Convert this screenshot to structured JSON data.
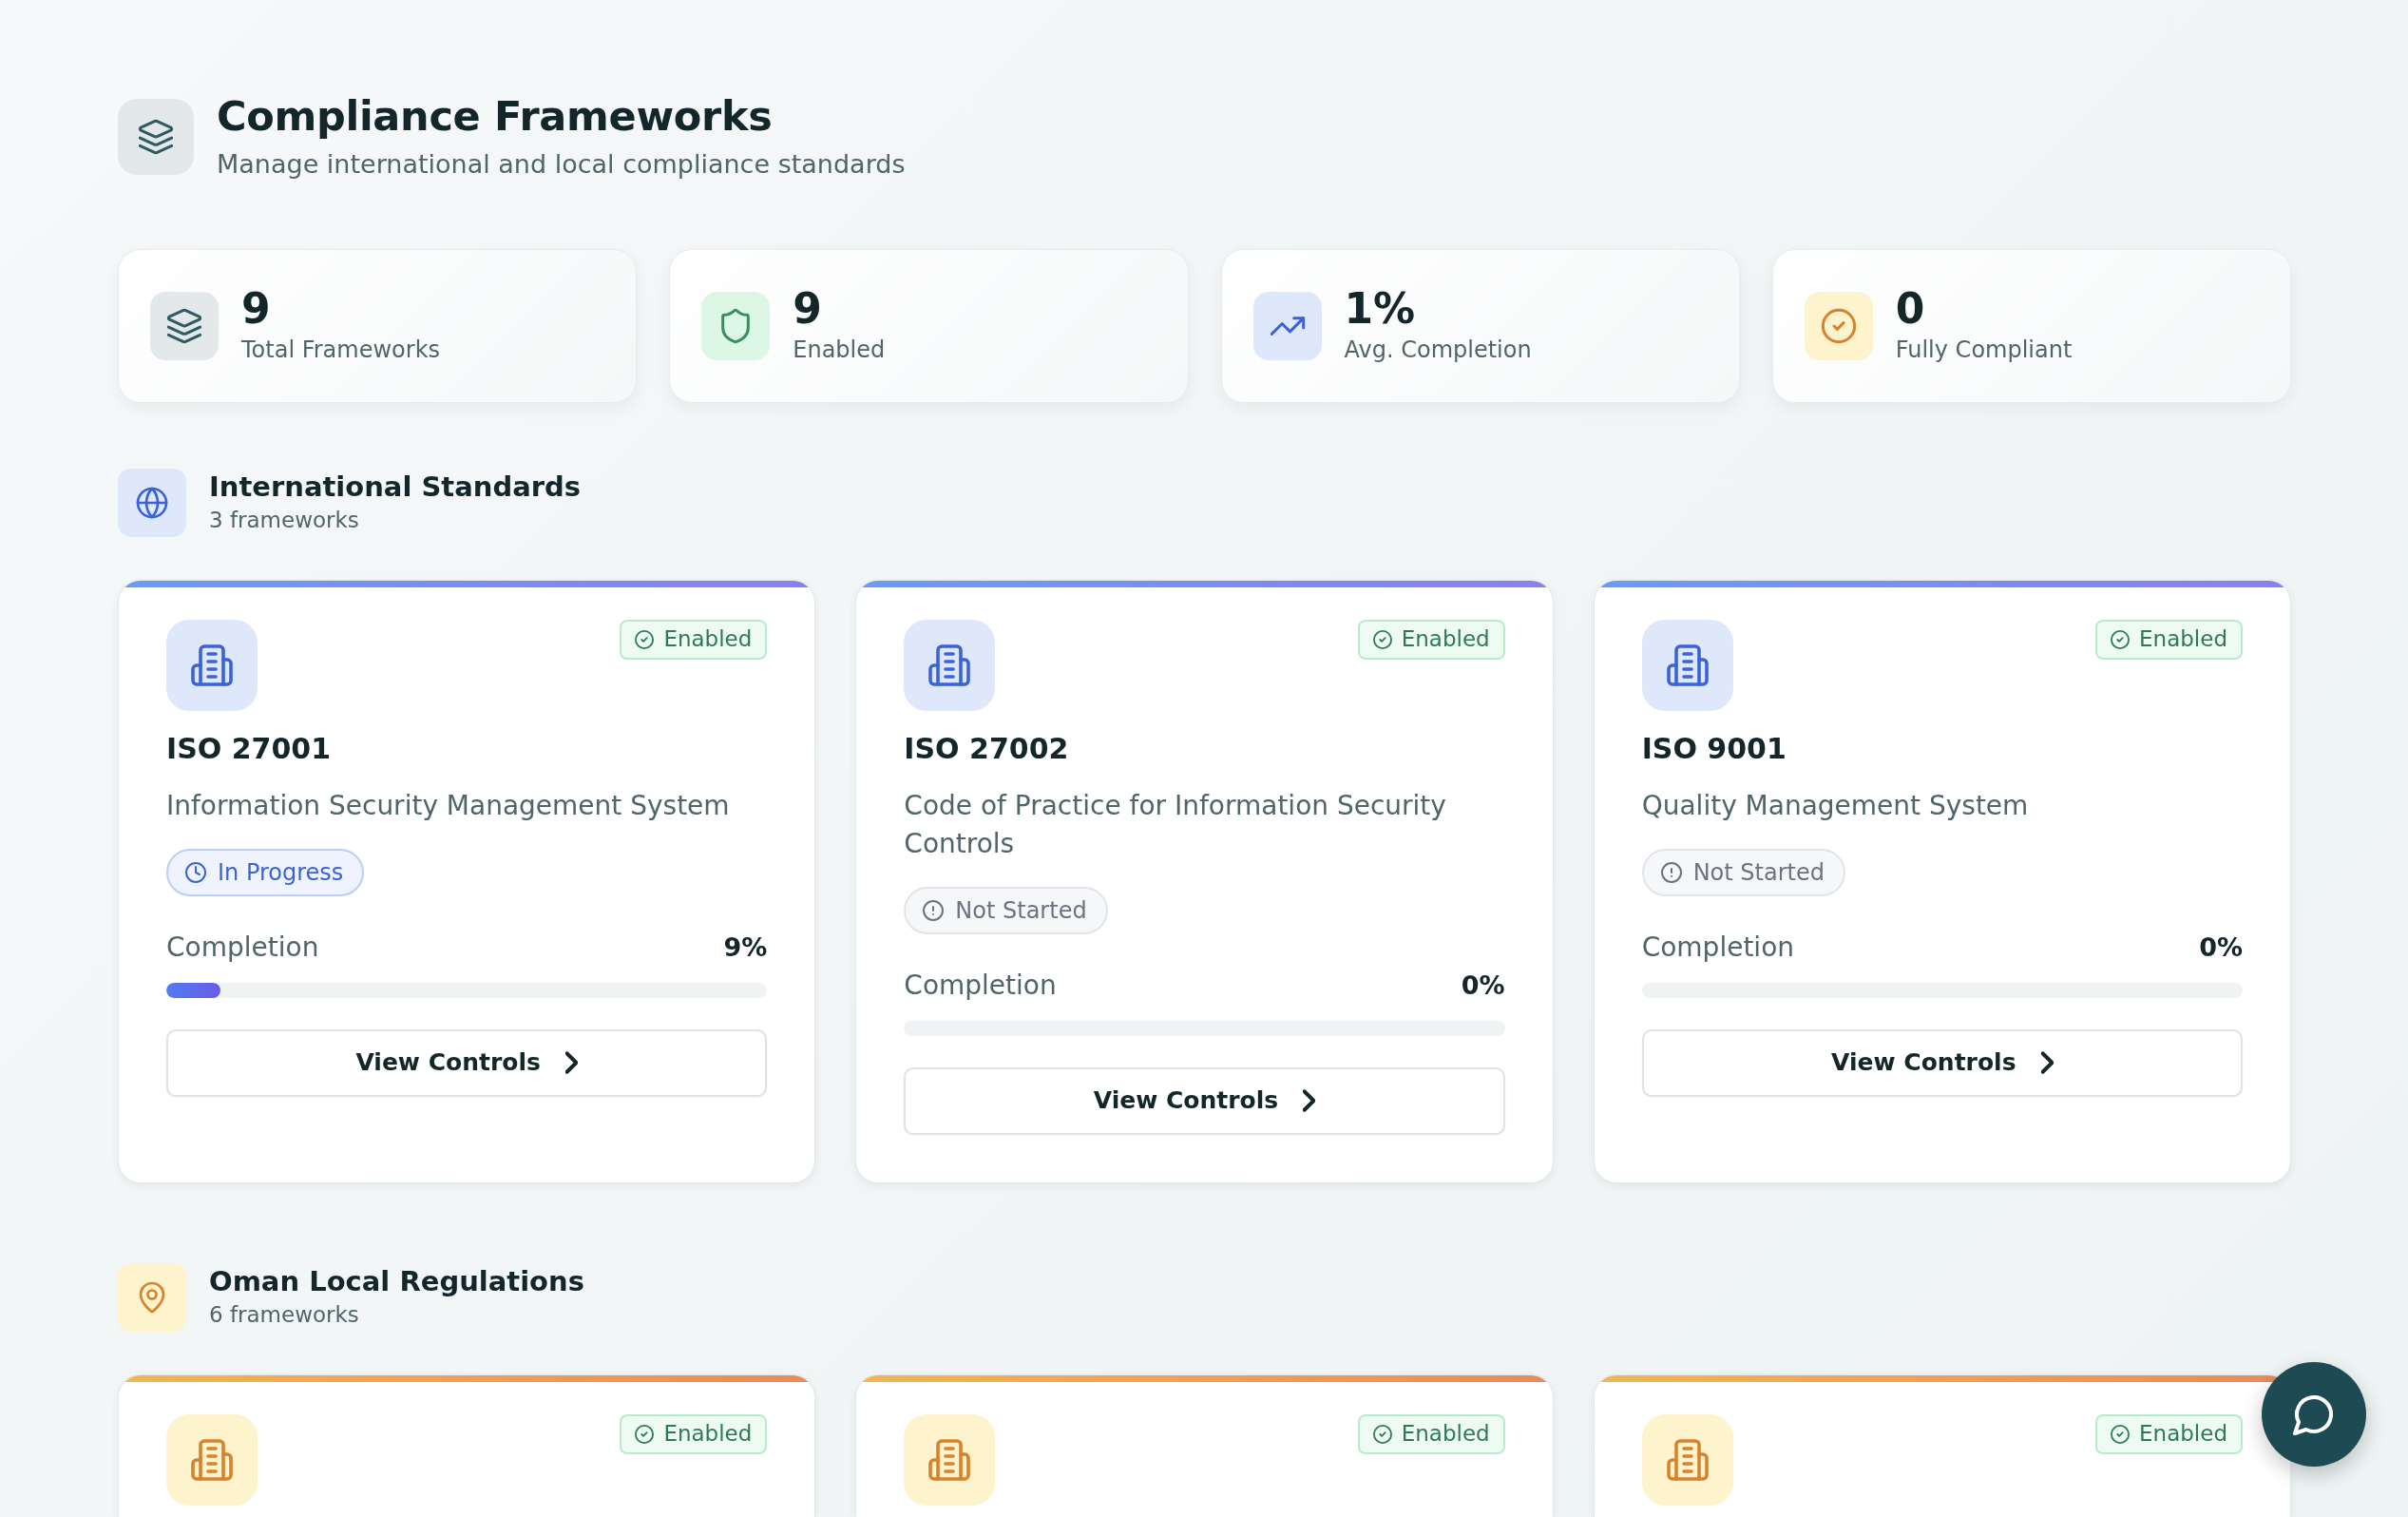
{
  "page": {
    "title": "Compliance Frameworks",
    "subtitle": "Manage international and local compliance standards"
  },
  "stats": [
    {
      "kind": "total",
      "value": "9",
      "label": "Total Frameworks"
    },
    {
      "kind": "enabled",
      "value": "9",
      "label": "Enabled"
    },
    {
      "kind": "completion",
      "value": "1%",
      "label": "Avg. Completion"
    },
    {
      "kind": "compliant",
      "value": "0",
      "label": "Fully Compliant"
    }
  ],
  "sections": [
    {
      "kind": "international",
      "title": "International Standards",
      "count": "3 frameworks",
      "frameworks": [
        {
          "name": "ISO 27001",
          "description": "Information Security Management System",
          "badge": "Enabled",
          "status": {
            "kind": "in_progress",
            "label": "In Progress"
          },
          "completion_label": "Completion",
          "completion": "9%",
          "level": 0.09,
          "button": "View Controls"
        },
        {
          "name": "ISO 27002",
          "description": "Code of Practice for Information Security Controls",
          "badge": "Enabled",
          "status": {
            "kind": "not_started",
            "label": "Not Started"
          },
          "completion_label": "Completion",
          "completion": "0%",
          "level": 0,
          "button": "View Controls"
        },
        {
          "name": "ISO 9001",
          "description": "Quality Management System",
          "badge": "Enabled",
          "status": {
            "kind": "not_started",
            "label": "Not Started"
          },
          "completion_label": "Completion",
          "completion": "0%",
          "level": 0,
          "button": "View Controls"
        }
      ]
    },
    {
      "kind": "local",
      "title": "Oman Local Regulations",
      "count": "6 frameworks",
      "frameworks": [
        {
          "badge": "Enabled"
        },
        {
          "badge": "Enabled"
        },
        {
          "badge": "Enabled"
        }
      ]
    }
  ]
}
